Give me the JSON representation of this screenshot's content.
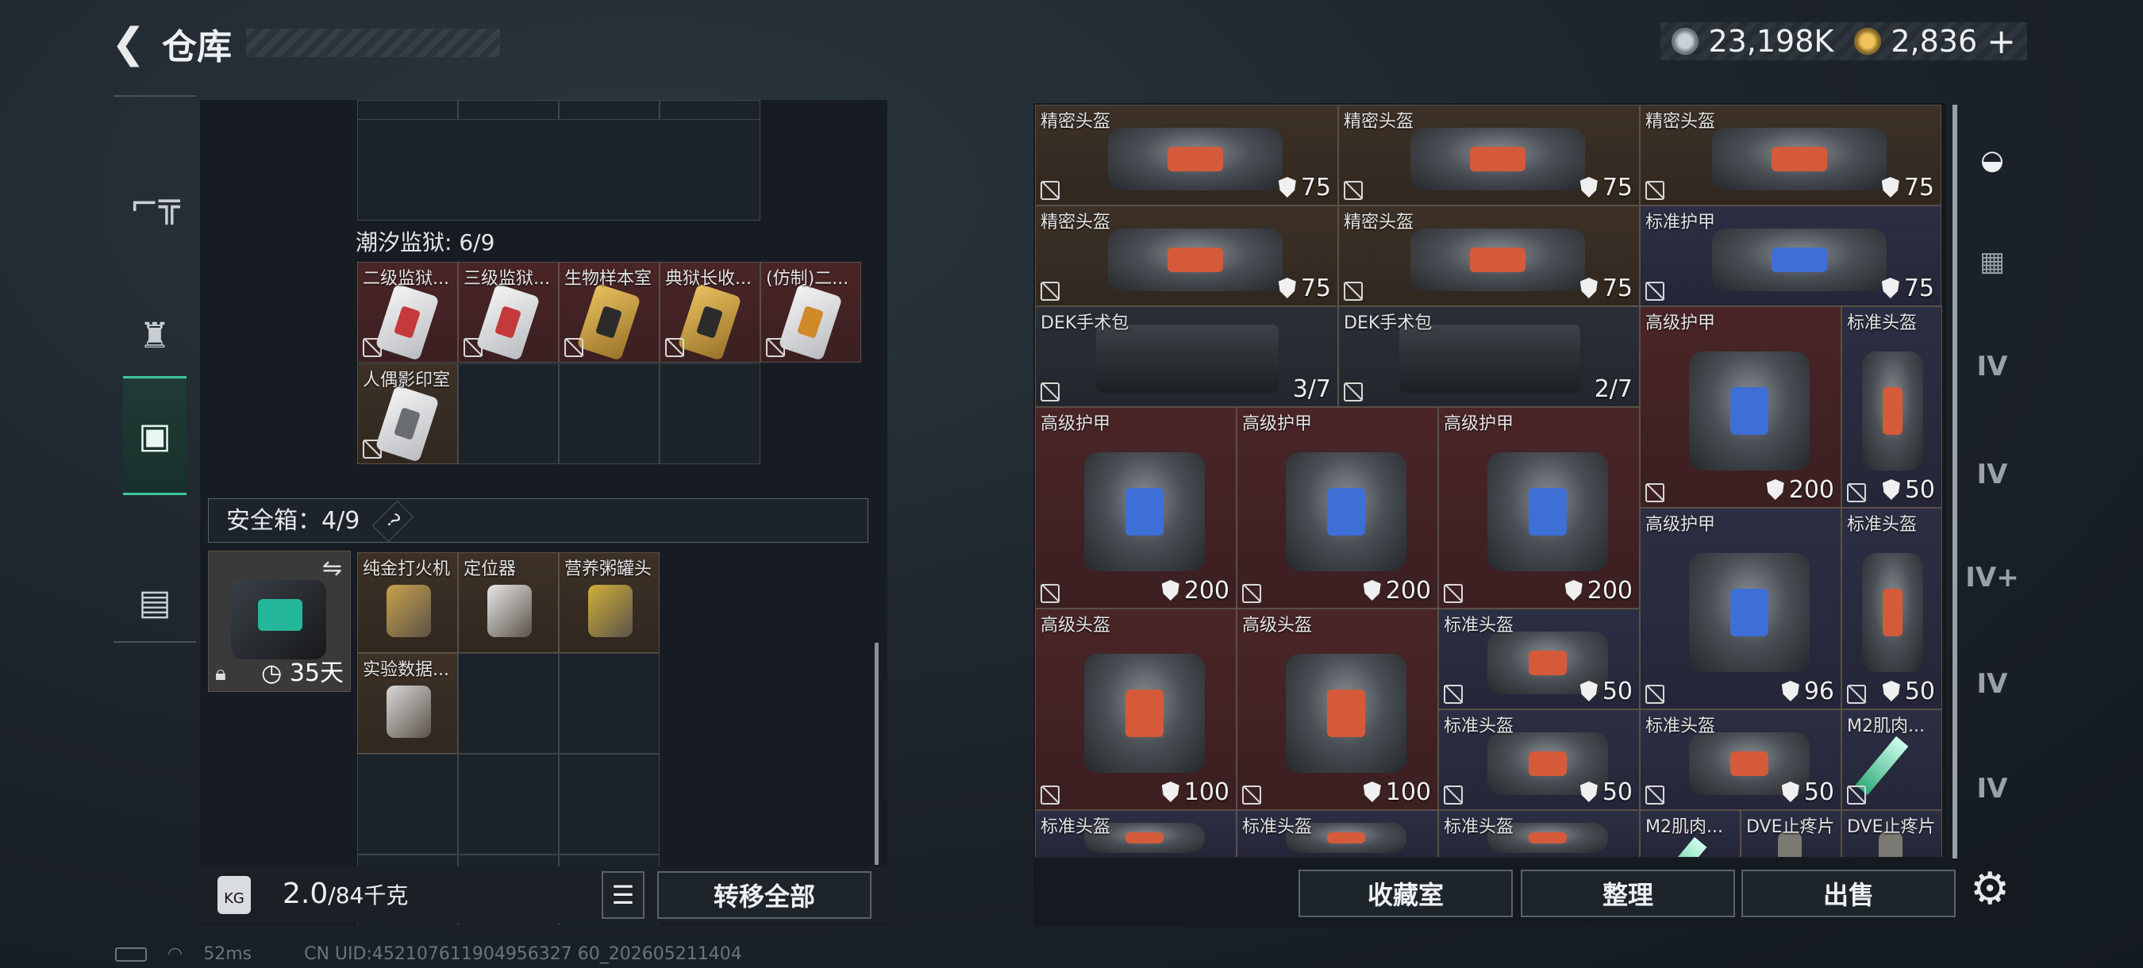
{
  "header": {
    "title": "仓库",
    "back_icon": "arrow-left-icon"
  },
  "currency": {
    "silver": "23,198K",
    "gold": "2,836",
    "add": "+"
  },
  "left_tabs": [
    {
      "name": "weapon-icon",
      "glyph": "⌐"
    },
    {
      "name": "backpack-icon",
      "glyph": "♜"
    },
    {
      "name": "container-icon",
      "glyph": "▣"
    },
    {
      "name": "briefcase-icon",
      "glyph": "▤"
    }
  ],
  "tidal_prison": {
    "label": "潮汐监狱: 6/9"
  },
  "cards": [
    {
      "name": "二级监狱...",
      "color": "#c43a3a",
      "gold": false
    },
    {
      "name": "三级监狱...",
      "color": "#c43a3a",
      "gold": false
    },
    {
      "name": "生物样本室",
      "color": "#2b2b2b",
      "gold": true
    },
    {
      "name": "典狱长收...",
      "color": "#2b2b2b",
      "gold": true
    },
    {
      "name": "(仿制)二...",
      "color": "#d08a2a",
      "gold": false
    },
    {
      "name": "人偶影印室",
      "color": "#6a6e73",
      "gold": false
    }
  ],
  "safebox": {
    "label": "安全箱：4/9",
    "help": "?",
    "days": "35天",
    "swap_icon": "swap-icon",
    "lock_icon": "lock-icon"
  },
  "safe_items": [
    "纯金打火机",
    "定位器",
    "营养粥罐头",
    "实验数据..."
  ],
  "weight": {
    "current": "2.0",
    "max": "/84千克",
    "kg": "KG"
  },
  "transfer_all": "转移全部",
  "right_items": [
    {
      "name": "精密头盔",
      "value": "75",
      "shield": true
    },
    {
      "name": "精密头盔",
      "value": "75",
      "shield": true
    },
    {
      "name": "精密头盔",
      "value": "75",
      "shield": true
    },
    {
      "name": "精密头盔",
      "value": "75",
      "shield": true
    },
    {
      "name": "精密头盔",
      "value": "75",
      "shield": true
    },
    {
      "name": "标准护甲",
      "value": "75",
      "shield": true
    },
    {
      "name": "DEK手术包",
      "value": "3/7",
      "shield": false
    },
    {
      "name": "DEK手术包",
      "value": "2/7",
      "shield": false
    },
    {
      "name": "高级护甲",
      "value": "200",
      "shield": true
    },
    {
      "name": "标准头盔",
      "value": "50",
      "shield": true
    },
    {
      "name": "高级护甲",
      "value": "200",
      "shield": true
    },
    {
      "name": "高级护甲",
      "value": "200",
      "shield": true
    },
    {
      "name": "高级护甲",
      "value": "200",
      "shield": true
    },
    {
      "name": "高级护甲",
      "value": "96",
      "shield": true
    },
    {
      "name": "标准头盔",
      "value": "50",
      "shield": true
    },
    {
      "name": "高级头盔",
      "value": "100",
      "shield": true
    },
    {
      "name": "高级头盔",
      "value": "100",
      "shield": true
    },
    {
      "name": "标准头盔",
      "value": "50",
      "shield": true
    },
    {
      "name": "标准头盔",
      "value": "50",
      "shield": true
    },
    {
      "name": "标准头盔",
      "value": "50",
      "shield": true
    },
    {
      "name": "M2肌肉...",
      "value": "",
      "shield": false
    },
    {
      "name": "标准头盔",
      "value": "",
      "shield": false
    },
    {
      "name": "标准头盔",
      "value": "",
      "shield": false
    },
    {
      "name": "标准头盔",
      "value": "",
      "shield": false
    },
    {
      "name": "M2肌肉...",
      "value": "",
      "shield": false
    },
    {
      "name": "DVE止疼片",
      "value": "",
      "shield": false
    },
    {
      "name": "DVE止疼片",
      "value": "",
      "shield": false
    }
  ],
  "bottom_buttons": {
    "collection": "收藏室",
    "organize": "整理",
    "sell": "出售"
  },
  "right_tabs": [
    {
      "name": "helmet-icon",
      "glyph": "◒"
    },
    {
      "name": "stash-icon",
      "glyph": "▦"
    },
    {
      "name": "folder-iv-icon",
      "glyph": "IV"
    },
    {
      "name": "folder-iv-icon",
      "glyph": "IV"
    },
    {
      "name": "folder-iv-add-icon",
      "glyph": "IV+"
    },
    {
      "name": "folder-iv-icon",
      "glyph": "IV"
    },
    {
      "name": "folder-iv-icon",
      "glyph": "IV"
    }
  ],
  "status": {
    "ping": "52ms",
    "uid": "CN UID:452107611904956327 60_202605211404"
  },
  "colors": {
    "accent": "#3ec79c",
    "red_bg": "#4a2527",
    "brown_bg": "#3d3127",
    "blue_bg": "#2c2f44"
  }
}
